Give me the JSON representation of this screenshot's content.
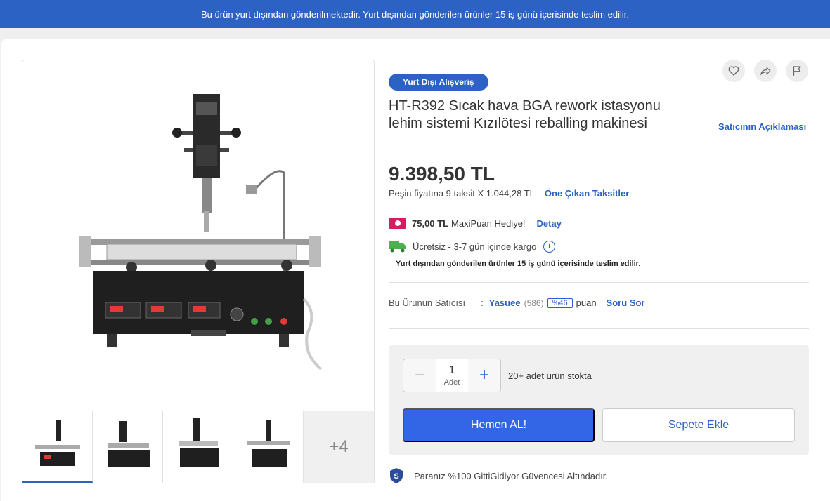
{
  "banner": {
    "text": "Bu ürün yurt dışından gönderilmektedir. Yurt dışından gönderilen ürünler 15 iş günü içerisinde teslim edilir."
  },
  "gallery": {
    "more_label": "+4"
  },
  "product": {
    "badge": "Yurt Dışı Alışveriş",
    "title": "HT-R392 Sıcak hava BGA rework istasyonu lehim sistemi Kızılötesi reballing makinesi",
    "seller_description_link": "Satıcının Açıklaması",
    "price": "9.398,50 TL",
    "installment_text": "Peşin fiyatına 9 taksit X 1.044,28 TL",
    "installment_link": "Öne Çıkan Taksitler",
    "maxipuan_amount": "75,00 TL",
    "maxipuan_text": "MaxiPuan Hediye!",
    "maxipuan_link": "Detay",
    "cargo_text": "Ücretsiz - 3-7 gün içinde kargo",
    "foreign_note": "Yurt dışından gönderilen ürünler 15 iş günü içerisinde teslim edilir."
  },
  "seller": {
    "label": "Bu Ürünün Satıcısı",
    "separator": ":",
    "name": "Yasuee",
    "review_count": "(586)",
    "score": "%46",
    "score_suffix": "puan",
    "ask_link": "Soru Sor"
  },
  "purchase": {
    "quantity": "1",
    "quantity_unit": "Adet",
    "minus": "−",
    "plus": "+",
    "stock_text": "20+ adet ürün stokta",
    "buy_now": "Hemen AL!",
    "add_to_cart": "Sepete Ekle"
  },
  "guarantee": {
    "text": "Paranız %100 GittiGidiyor Güvencesi Altındadır."
  },
  "colors": {
    "brand_blue": "#2b62c4",
    "button_blue": "#3366e6",
    "maxipuan_pink": "#d81b60",
    "cargo_green": "#4caf50"
  }
}
